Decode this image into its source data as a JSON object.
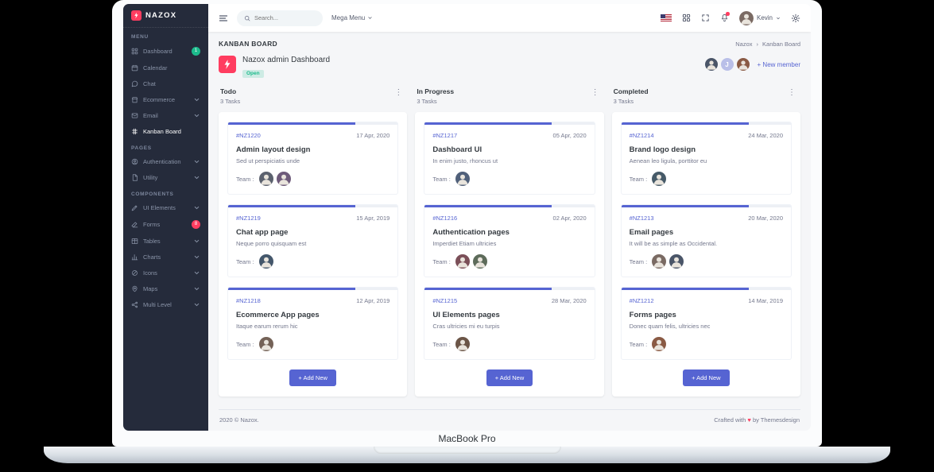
{
  "frame": {
    "device_label": "MacBook Pro"
  },
  "topbar": {
    "logo_text": "NAZOX",
    "search_placeholder": "Search...",
    "mega_menu_label": "Mega Menu",
    "user_name": "Kevin"
  },
  "sidebar": {
    "sections": [
      {
        "label": "MENU",
        "items": [
          {
            "label": "Dashboard",
            "icon": "dashboard",
            "badge": "1",
            "badge_color": "#1cbb8c"
          },
          {
            "label": "Calendar",
            "icon": "calendar"
          },
          {
            "label": "Chat",
            "icon": "chat"
          },
          {
            "label": "Ecommerce",
            "icon": "store",
            "chevron": true
          },
          {
            "label": "Email",
            "icon": "mail",
            "chevron": true
          },
          {
            "label": "Kanban Board",
            "icon": "kanban",
            "active": true
          }
        ]
      },
      {
        "label": "PAGES",
        "items": [
          {
            "label": "Authentication",
            "icon": "auth",
            "chevron": true
          },
          {
            "label": "Utility",
            "icon": "utility",
            "chevron": true
          }
        ]
      },
      {
        "label": "COMPONENTS",
        "items": [
          {
            "label": "UI Elements",
            "icon": "ui",
            "chevron": true
          },
          {
            "label": "Forms",
            "icon": "forms",
            "badge": "8",
            "badge_color": "#ff3d60"
          },
          {
            "label": "Tables",
            "icon": "tables",
            "chevron": true
          },
          {
            "label": "Charts",
            "icon": "charts",
            "chevron": true
          },
          {
            "label": "Icons",
            "icon": "icons",
            "chevron": true
          },
          {
            "label": "Maps",
            "icon": "maps",
            "chevron": true
          },
          {
            "label": "Multi Level",
            "icon": "multilevel",
            "chevron": true
          }
        ]
      }
    ]
  },
  "page": {
    "title": "KANBAN BOARD",
    "breadcrumb": [
      "Nazox",
      "Kanban Board"
    ],
    "board": {
      "name": "Nazox admin Dashboard",
      "status_badge": "Open",
      "members": [
        {
          "type": "photo"
        },
        {
          "type": "letter",
          "text": "J"
        },
        {
          "type": "photo"
        }
      ],
      "new_member_label": "+ New member"
    }
  },
  "labels": {
    "team": "Team :",
    "add_new": "+ Add New"
  },
  "ui": {
    "breadcrumb_separator": "›",
    "column_menu_glyph": "⋮",
    "heart": "♥"
  },
  "columns": [
    {
      "name": "Todo",
      "count": "3 Tasks",
      "tasks": [
        {
          "id": "#NZ1220",
          "date": "17 Apr, 2020",
          "title": "Admin layout design",
          "desc": "Sed ut perspiciatis unde",
          "team": 2,
          "progress": 75
        },
        {
          "id": "#NZ1219",
          "date": "15 Apr, 2019",
          "title": "Chat app page",
          "desc": "Neque porro quisquam est",
          "team": 1,
          "progress": 75
        },
        {
          "id": "#NZ1218",
          "date": "12 Apr, 2019",
          "title": "Ecommerce App pages",
          "desc": "Itaque earum rerum hic",
          "team": 1,
          "progress": 75
        }
      ]
    },
    {
      "name": "In Progress",
      "count": "3 Tasks",
      "tasks": [
        {
          "id": "#NZ1217",
          "date": "05 Apr, 2020",
          "title": "Dashboard UI",
          "desc": "In enim justo, rhoncus ut",
          "team": 1,
          "progress": 75
        },
        {
          "id": "#NZ1216",
          "date": "02 Apr, 2020",
          "title": "Authentication pages",
          "desc": "Imperdiet Etiam ultricies",
          "team": 2,
          "progress": 75
        },
        {
          "id": "#NZ1215",
          "date": "28 Mar, 2020",
          "title": "UI Elements pages",
          "desc": "Cras ultricies mi eu turpis",
          "team": 1,
          "progress": 75
        }
      ]
    },
    {
      "name": "Completed",
      "count": "3 Tasks",
      "tasks": [
        {
          "id": "#NZ1214",
          "date": "24 Mar, 2020",
          "title": "Brand logo design",
          "desc": "Aenean leo ligula, porttitor eu",
          "team": 1,
          "progress": 75
        },
        {
          "id": "#NZ1213",
          "date": "20 Mar, 2020",
          "title": "Email pages",
          "desc": "It will be as simple as Occidental.",
          "team": 2,
          "progress": 75
        },
        {
          "id": "#NZ1212",
          "date": "14 Mar, 2019",
          "title": "Forms pages",
          "desc": "Donec quam felis, ultricies nec",
          "team": 1,
          "progress": 75
        }
      ]
    }
  ],
  "footer": {
    "left": "2020 © Nazox.",
    "right_prefix": "Crafted with",
    "right_suffix": "by Themesdesign"
  },
  "colors": {
    "primary": "#5664d2",
    "danger": "#ff3d60",
    "success": "#1cbb8c",
    "sidebar_bg": "#252b3b"
  }
}
